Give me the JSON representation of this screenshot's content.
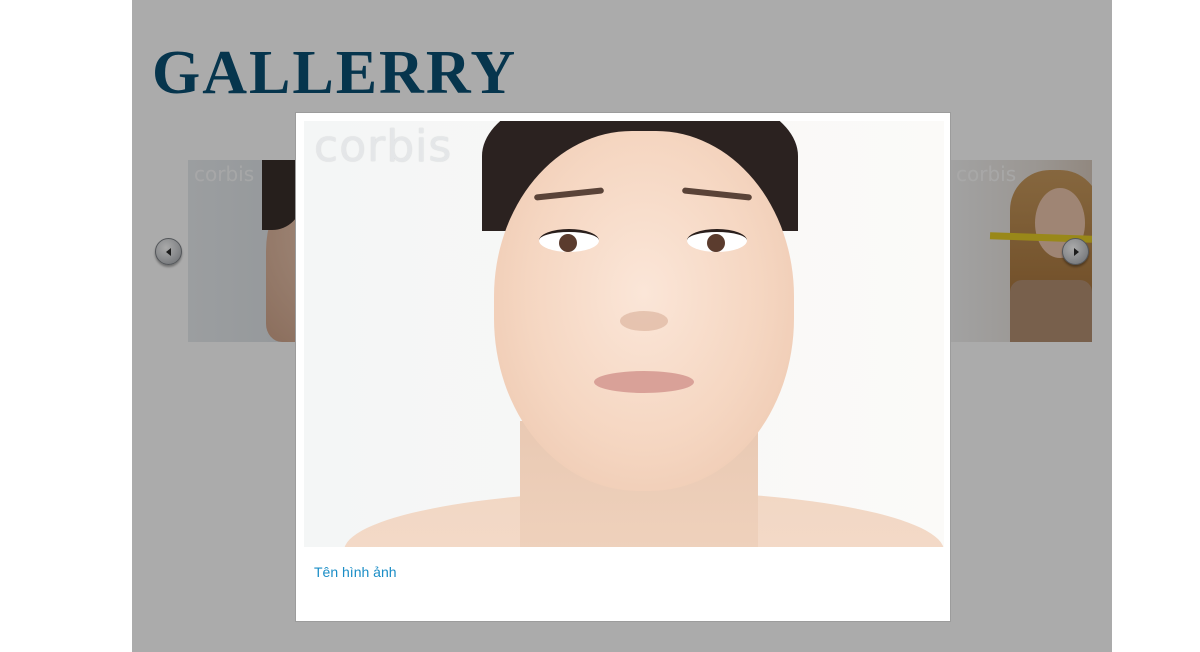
{
  "gallery": {
    "title": "GALLERRY",
    "prev_icon": "chevron-left-icon",
    "next_icon": "chevron-right-icon",
    "thumbnails": [
      {
        "watermark": "corbis"
      },
      {
        "watermark": "corbis"
      }
    ]
  },
  "lightbox": {
    "watermark": "corbis",
    "caption": "Tên hình ảnh"
  },
  "colors": {
    "title": "#0a4f74",
    "caption_link": "#1a8dc6",
    "overlay": "#000000"
  }
}
